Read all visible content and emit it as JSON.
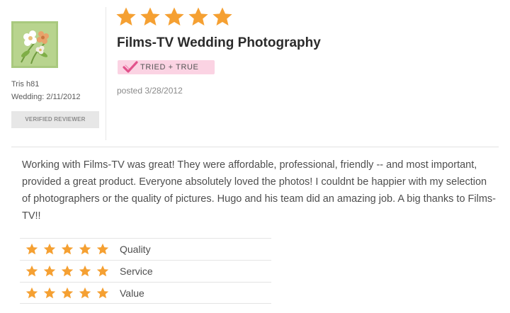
{
  "colors": {
    "star": "#f5a032",
    "badge_bg": "#fbd3e3",
    "badge_check": "#e2528c"
  },
  "reviewer": {
    "avatar_icon": "flower-bouquet-avatar",
    "name": "Tris h81",
    "wedding": "Wedding: 2/11/2012",
    "verified_label": "VERIFIED REVIEWER"
  },
  "review": {
    "overall_rating": 5,
    "rating_max": 5,
    "vendor_title": "Films-TV Wedding Photography",
    "badge": {
      "icon": "checkmark-icon",
      "label": "TRIED + TRUE"
    },
    "posted": "posted 3/28/2012",
    "text": "Working with Films-TV was great! They were affordable, professional, friendly -- and most important, provided a great product. Everyone absolutely loved the photos! I couldnt be happier with my selection of photographers or the quality of pictures. Hugo and his team did an amazing job. A big thanks to Films-TV!!"
  },
  "ratings": [
    {
      "label": "Quality",
      "stars": 5
    },
    {
      "label": "Service",
      "stars": 5
    },
    {
      "label": "Value",
      "stars": 5
    }
  ]
}
